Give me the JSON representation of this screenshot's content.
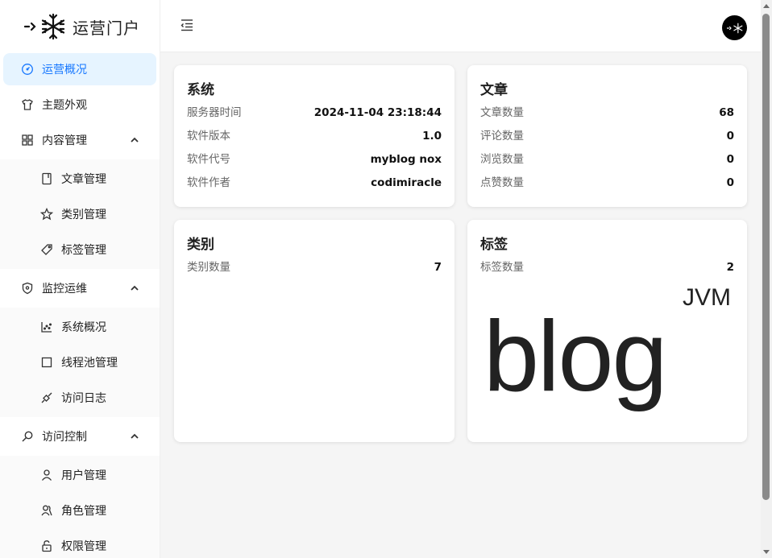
{
  "brand": {
    "title": "运营门户",
    "logo_icon": "snowflake-logo-icon"
  },
  "sidebar": {
    "overview": {
      "label": "运营概况",
      "icon": "dashboard-icon"
    },
    "theme": {
      "label": "主题外观",
      "icon": "shirt-icon"
    },
    "content": {
      "label": "内容管理",
      "icon": "grid-icon",
      "items": [
        {
          "label": "文章管理",
          "icon": "book-icon"
        },
        {
          "label": "类别管理",
          "icon": "star-icon"
        },
        {
          "label": "标签管理",
          "icon": "tag-icon"
        }
      ]
    },
    "monitor": {
      "label": "监控运维",
      "icon": "shield-icon",
      "items": [
        {
          "label": "系统概况",
          "icon": "chart-dots-icon"
        },
        {
          "label": "线程池管理",
          "icon": "square-icon"
        },
        {
          "label": "访问日志",
          "icon": "link-icon"
        }
      ]
    },
    "access": {
      "label": "访问控制",
      "icon": "search-key-icon",
      "items": [
        {
          "label": "用户管理",
          "icon": "user-icon"
        },
        {
          "label": "角色管理",
          "icon": "users-icon"
        },
        {
          "label": "权限管理",
          "icon": "lock-icon"
        }
      ]
    }
  },
  "cards": {
    "system": {
      "title": "系统",
      "rows": [
        {
          "k": "服务器时间",
          "v": "2024-11-04 23:18:44"
        },
        {
          "k": "软件版本",
          "v": "1.0"
        },
        {
          "k": "软件代号",
          "v": "myblog nox"
        },
        {
          "k": "软件作者",
          "v": "codimiracle"
        }
      ]
    },
    "article": {
      "title": "文章",
      "rows": [
        {
          "k": "文章数量",
          "v": "68"
        },
        {
          "k": "评论数量",
          "v": "0"
        },
        {
          "k": "浏览数量",
          "v": "0"
        },
        {
          "k": "点赞数量",
          "v": "0"
        }
      ]
    },
    "category": {
      "title": "类别",
      "rows": [
        {
          "k": "类别数量",
          "v": "7"
        }
      ]
    },
    "tag": {
      "title": "标签",
      "rows": [
        {
          "k": "标签数量",
          "v": "2"
        }
      ],
      "cloud": [
        "JVM",
        "blog"
      ]
    }
  },
  "colors": {
    "accent": "#1677ff",
    "active_bg": "#e6f4ff",
    "main_bg": "#f5f5f5"
  }
}
